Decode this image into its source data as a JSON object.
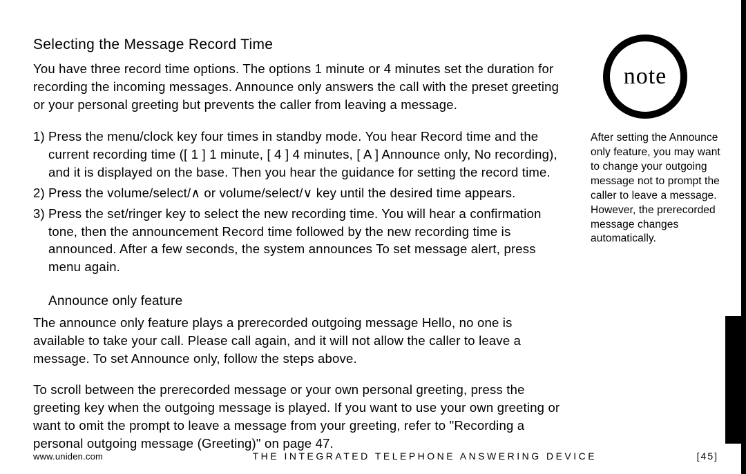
{
  "heading": "Selecting the Message Record Time",
  "intro": "You have three record time options. The options 1 minute or 4 minutes set the duration for recording the incoming messages. Announce only answers the call with the preset greeting or your personal greeting but prevents the caller from leaving a message.",
  "steps": [
    {
      "num": "1)",
      "body": "Press the menu/clock key four times in standby mode.\nYou hear Record time and the current recording time ([ 1 ] 1 minute, [ 4 ] 4 minutes, [ A ] Announce only, No recording), and it is displayed on the base. Then you hear the guidance for setting the record time."
    },
    {
      "num": "2)",
      "body": "Press the volume/select/∧ or volume/select/∨ key until the desired time appears."
    },
    {
      "num": "3)",
      "body": "Press the set/ringer key to select the new recording time. You will hear a confirmation tone, then the announcement Record time followed by the new recording time is announced. After a few seconds, the system announces To set message alert, press menu again."
    }
  ],
  "subheading": "Announce only feature",
  "announce_para": "The announce only feature plays a prerecorded outgoing message Hello, no one is available to take your call. Please call again, and it will not allow the caller to leave a message. To set Announce only, follow the steps above.",
  "scroll_para": "To scroll between the prerecorded message or your own personal greeting, press the greeting key when the outgoing message is played. If you want to use your own greeting or want to omit the prompt to leave a message from your greeting, refer to \"Recording a personal outgoing message (Greeting)\" on page 47.",
  "note": {
    "label": "note",
    "text": "After setting the Announce only feature, you may want to change your outgoing message not to prompt the caller to leave a message. However, the prerecorded message changes automatically."
  },
  "footer": {
    "url": "www.uniden.com",
    "title": "THE INTEGRATED TELEPHONE ANSWERING DEVICE",
    "page": "[45]"
  }
}
